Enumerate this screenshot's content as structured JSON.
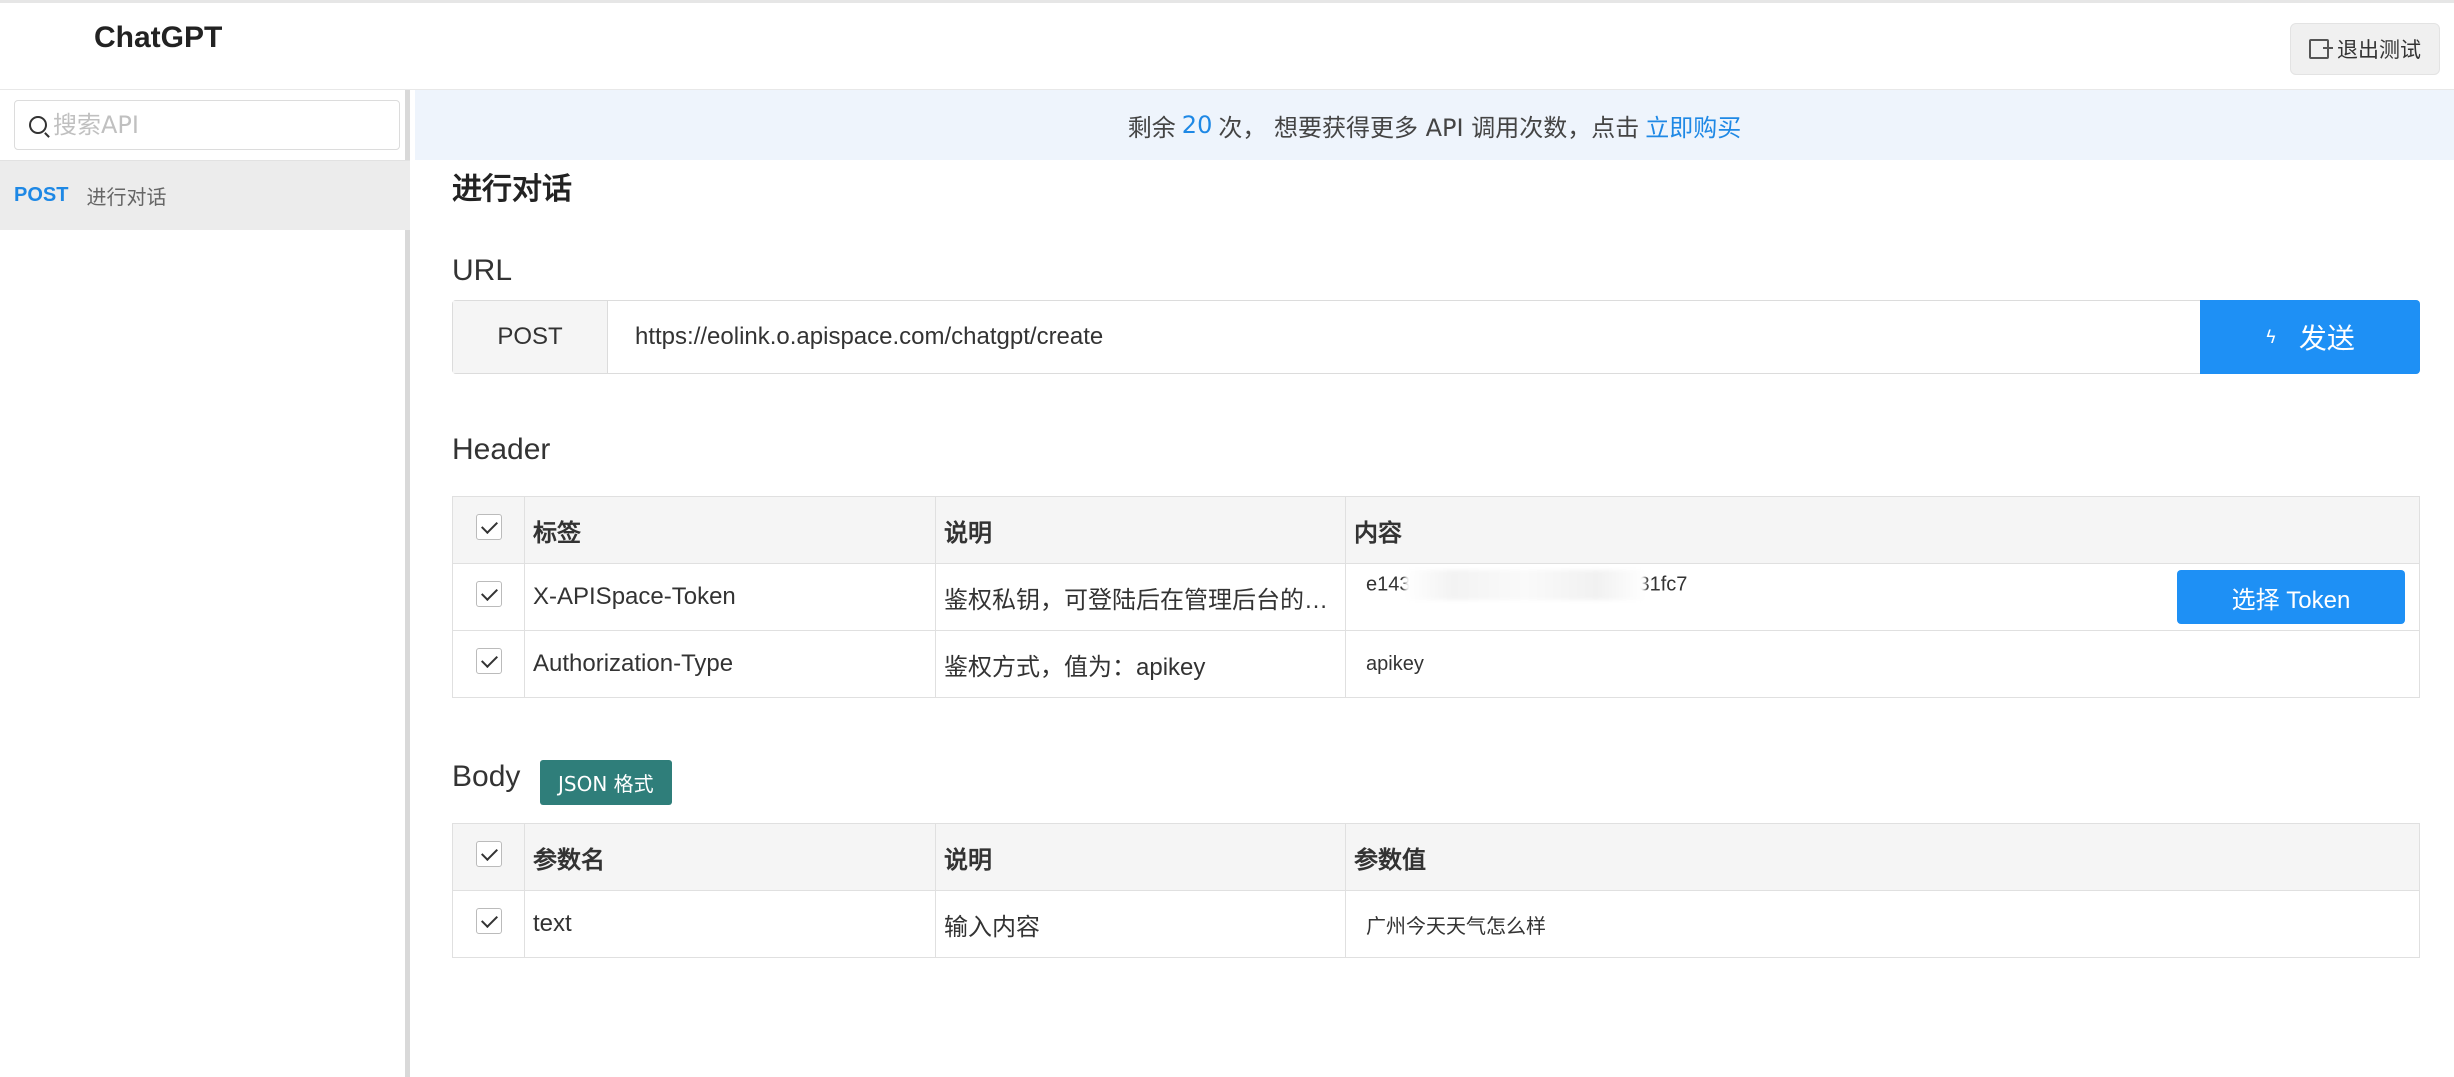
{
  "header": {
    "title": "ChatGPT",
    "exit_label": "退出测试"
  },
  "sidebar": {
    "search_placeholder": "搜索API",
    "items": [
      {
        "method": "POST",
        "label": "进行对话"
      }
    ]
  },
  "banner": {
    "prefix": "剩余",
    "count": "20",
    "suffix": "次，  想要获得更多 API 调用次数，点击",
    "link": "立即购买"
  },
  "main": {
    "title": "进行对话",
    "url_section": "URL",
    "method": "POST",
    "url": "https://eolink.o.apispace.com/chatgpt/create",
    "send_label": "发送",
    "header_section": "Header",
    "header_columns": [
      "标签",
      "说明",
      "内容"
    ],
    "header_rows": [
      {
        "key": "X-APISpace-Token",
        "desc": "鉴权私钥，可登陆后在管理后台的…",
        "value_start": "e143",
        "value_end": "31fc7",
        "button": "选择 Token"
      },
      {
        "key": "Authorization-Type",
        "desc": "鉴权方式，值为：apikey",
        "value": "apikey"
      }
    ],
    "body_section": "Body",
    "body_badge": "JSON 格式",
    "body_columns": [
      "参数名",
      "说明",
      "参数值"
    ],
    "body_rows": [
      {
        "key": "text",
        "desc": "输入内容",
        "value": "广州今天天气怎么样"
      }
    ]
  }
}
